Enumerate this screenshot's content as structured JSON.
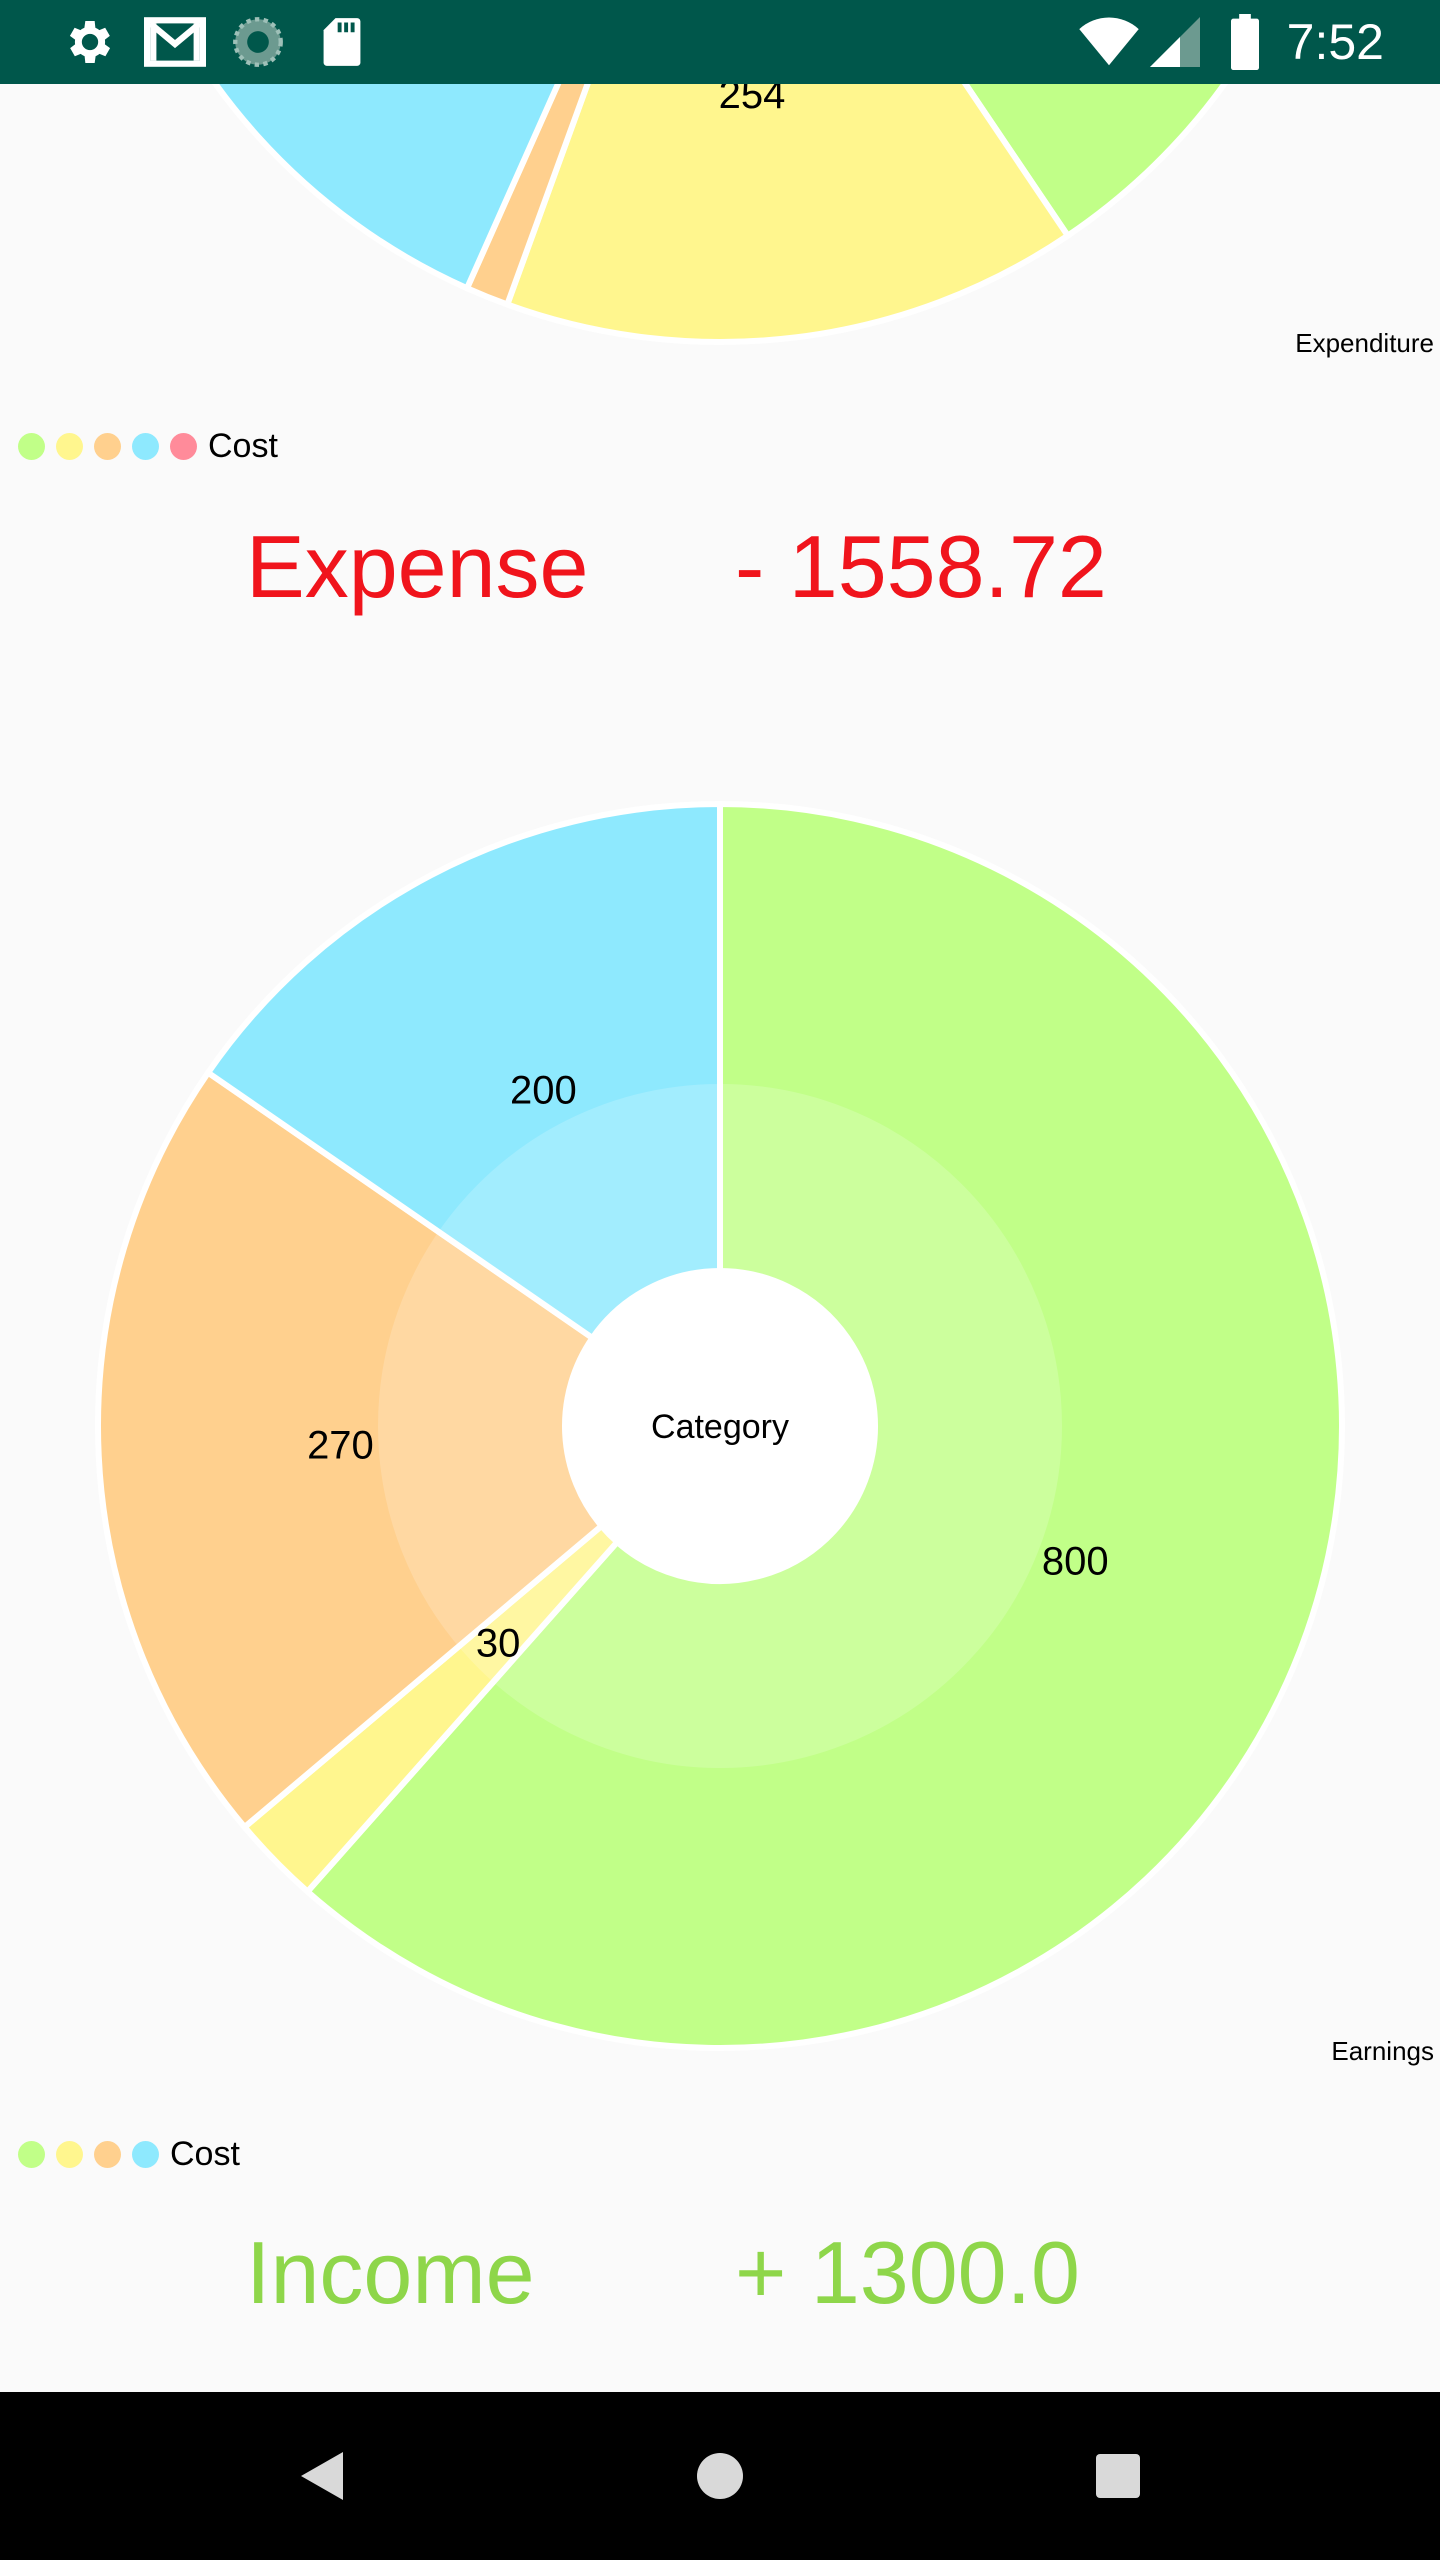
{
  "status_bar": {
    "time": "7:52",
    "icons": [
      "settings-icon",
      "gmail-icon",
      "sync-icon",
      "sd-card-icon",
      "wifi-icon",
      "signal-icon",
      "battery-icon"
    ],
    "background": "#00574b"
  },
  "colors": {
    "green": "#c1ff88",
    "yellow": "#fff68e",
    "orange": "#ffd08e",
    "blue": "#8ee9fe",
    "pink": "#ff8b9a",
    "expense_red": "#f0141c",
    "income_green": "#8ed64a"
  },
  "chart_data": [
    {
      "type": "pie",
      "description": "Expenditure",
      "legend_label": "Cost",
      "slice_colors": [
        "#c1ff88",
        "#fff68e",
        "#ffd08e",
        "#8ee9fe",
        "#ff8b9a"
      ],
      "visible_labels": [
        "254"
      ]
    },
    {
      "type": "pie",
      "description": "Earnings",
      "center_text": "Category",
      "legend_label": "Cost",
      "slices": [
        {
          "value": 800,
          "color": "#c1ff88"
        },
        {
          "value": 30,
          "color": "#fff68e"
        },
        {
          "value": 270,
          "color": "#ffd08e"
        },
        {
          "value": 200,
          "color": "#8ee9fe"
        }
      ]
    }
  ],
  "expense": {
    "label": "Expense",
    "amount": "- 1558.72"
  },
  "income": {
    "label": "Income",
    "amount": "+ 1300.0"
  },
  "nav": {
    "buttons": [
      "back-icon",
      "home-icon",
      "recents-icon"
    ]
  }
}
